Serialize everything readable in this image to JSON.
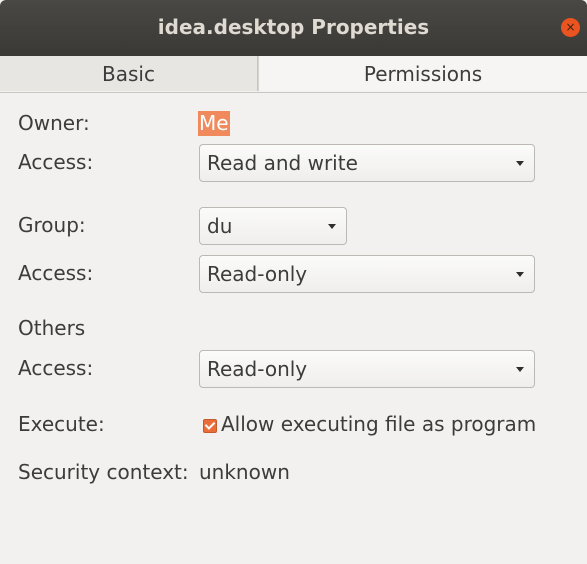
{
  "window": {
    "title": "idea.desktop Properties",
    "close_glyph": "×"
  },
  "tabs": [
    {
      "label": "Basic",
      "selected": false
    },
    {
      "label": "Permissions",
      "selected": true
    }
  ],
  "owner": {
    "label": "Owner:",
    "value": "Me",
    "access_label": "Access:",
    "access_value": "Read and write"
  },
  "group": {
    "label": "Group:",
    "value": "du",
    "access_label": "Access:",
    "access_value": "Read-only"
  },
  "others": {
    "label": "Others",
    "access_label": "Access:",
    "access_value": "Read-only"
  },
  "execute": {
    "label": "Execute:",
    "checkbox_label": "Allow executing file as program",
    "checked": true
  },
  "security": {
    "label": "Security context:",
    "value": "unknown"
  },
  "colors": {
    "accent": "#e95420",
    "highlight": "#f08a5d",
    "titlebar": "#3b3935"
  }
}
